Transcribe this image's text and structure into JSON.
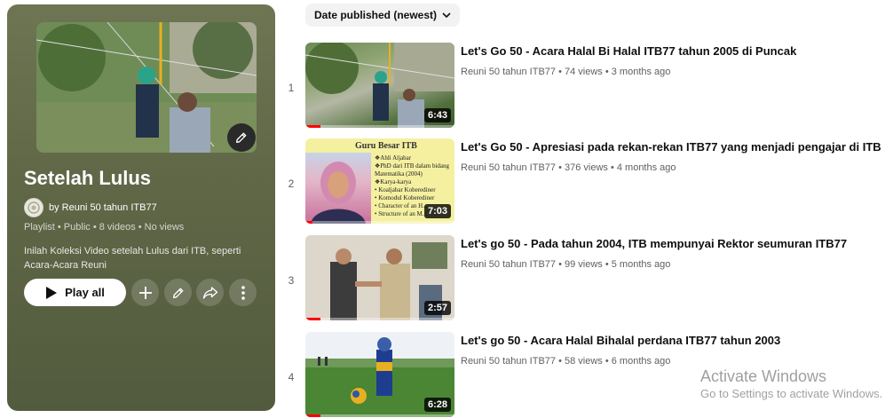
{
  "playlist": {
    "title": "Setelah Lulus",
    "owner": "by Reuni 50 tahun ITB77",
    "meta": "Playlist • Public • 8 videos • No views",
    "description": "Inilah Koleksi Video setelah Lulus dari ITB, seperti Acara-Acara Reuni",
    "play_all_label": "Play all"
  },
  "sort": {
    "label": "Date published (newest)"
  },
  "videos": [
    {
      "index": "1",
      "title": "Let's Go 50 - Acara Halal Bi Halal ITB77 tahun 2005 di Puncak",
      "meta": "Reuni 50 tahun ITB77 • 74 views • 3 months ago",
      "duration": "6:43",
      "progress": 0.1
    },
    {
      "index": "2",
      "title": "Let's Go 50 - Apresiasi pada rekan-rekan ITB77 yang menjadi pengajar di ITB",
      "meta": "Reuni 50 tahun ITB77 • 376 views • 4 months ago",
      "duration": "7:03",
      "progress": 0.05,
      "slide_title": "Guru Besar ITB",
      "slide_bullets": [
        "❖Ahli Aljabar",
        "❖PhD dari ITB dalam bidang",
        "  Matematika (2004)",
        "❖Karya-karya",
        "  • Koaljabar Koberediner",
        "  • Komodul Koberediner",
        "  • Character of an H...",
        "  • Structure of an M..."
      ]
    },
    {
      "index": "3",
      "title": "Let's go 50 - Pada tahun 2004, ITB mempunyai Rektor seumuran ITB77",
      "meta": "Reuni 50 tahun ITB77 • 99 views • 5 months ago",
      "duration": "2:57",
      "progress": 0.1
    },
    {
      "index": "4",
      "title": "Let's go 50 - Acara Halal Bihalal perdana ITB77 tahun 2003",
      "meta": "Reuni 50 tahun ITB77 • 58 views • 6 months ago",
      "duration": "6:28",
      "progress": 0.1
    }
  ],
  "watermark": {
    "title": "Activate Windows",
    "subtitle": "Go to Settings to activate Windows."
  },
  "colors": {
    "progress": "#ff0000",
    "panel": "#5f6747"
  }
}
